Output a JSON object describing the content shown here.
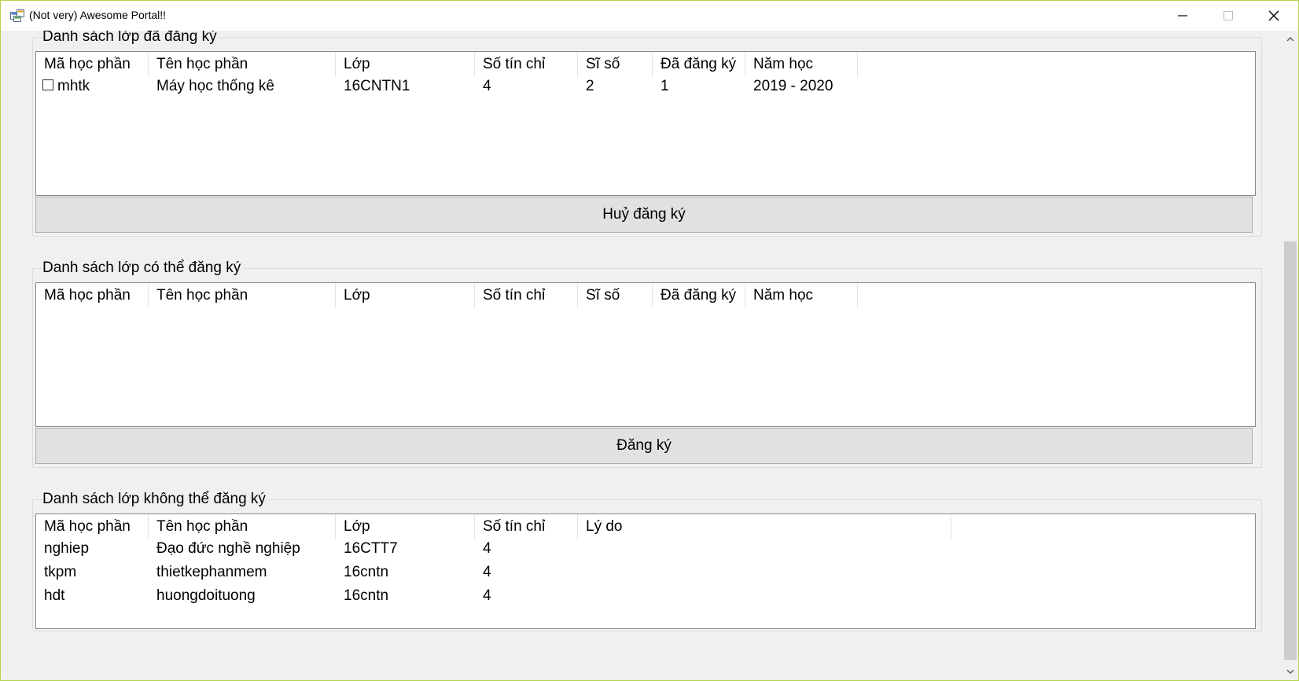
{
  "window": {
    "title": "(Not very) Awesome Portal!!",
    "icon": "app-window-icon"
  },
  "registered": {
    "legend": "Danh sách lớp đã đăng ký",
    "columns": [
      "Mã học phần",
      "Tên học phần",
      "Lớp",
      "Số tín chỉ",
      "Sĩ số",
      "Đã đăng ký",
      "Năm học"
    ],
    "rows": [
      {
        "checked": false,
        "cells": [
          "mhtk",
          "Máy học thống kê",
          "16CNTN1",
          "4",
          "2",
          "1",
          "2019 - 2020"
        ]
      }
    ],
    "button_label": "Huỷ đăng ký"
  },
  "available": {
    "legend": "Danh sách lớp có thể đăng ký",
    "columns": [
      "Mã học phần",
      "Tên học phần",
      "Lớp",
      "Số tín chỉ",
      "Sĩ số",
      "Đã đăng ký",
      "Năm học"
    ],
    "rows": [],
    "button_label": "Đăng ký"
  },
  "unavailable": {
    "legend": "Danh sách lớp không thể đăng ký",
    "columns": [
      "Mã học phần",
      "Tên học phần",
      "Lớp",
      "Số tín chỉ",
      "Lý do"
    ],
    "rows": [
      {
        "cells": [
          "nghiep",
          "Đạo đức nghề nghiệp",
          "16CTT7",
          "4",
          ""
        ]
      },
      {
        "cells": [
          "tkpm",
          "thietkephanmem",
          "16cntn",
          "4",
          ""
        ]
      },
      {
        "cells": [
          "hdt",
          "huongdoituong",
          "16cntn",
          "4",
          ""
        ]
      }
    ]
  }
}
